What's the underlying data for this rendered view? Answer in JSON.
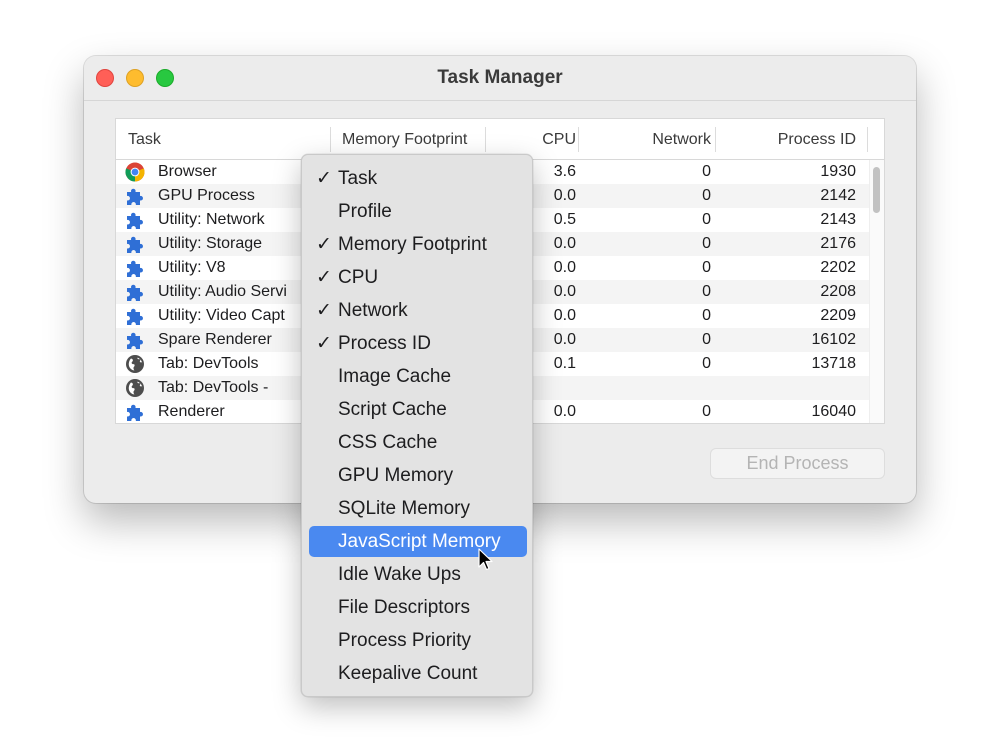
{
  "window": {
    "title": "Task Manager"
  },
  "table": {
    "columns": [
      "Task",
      "Memory Footprint",
      "CPU",
      "Network",
      "Process ID"
    ],
    "rows": [
      {
        "icon": "chrome-icon",
        "task": "Browser",
        "cpu": "3.6",
        "network": "0",
        "pid": "1930"
      },
      {
        "icon": "puzzle-icon",
        "task": "GPU Process",
        "cpu": "0.0",
        "network": "0",
        "pid": "2142"
      },
      {
        "icon": "puzzle-icon",
        "task": "Utility: Network",
        "cpu": "0.5",
        "network": "0",
        "pid": "2143"
      },
      {
        "icon": "puzzle-icon",
        "task": "Utility: Storage",
        "cpu": "0.0",
        "network": "0",
        "pid": "2176"
      },
      {
        "icon": "puzzle-icon",
        "task": "Utility: V8",
        "cpu": "0.0",
        "network": "0",
        "pid": "2202"
      },
      {
        "icon": "puzzle-icon",
        "task": "Utility: Audio Servi",
        "cpu": "0.0",
        "network": "0",
        "pid": "2208"
      },
      {
        "icon": "puzzle-icon",
        "task": "Utility: Video Capt",
        "cpu": "0.0",
        "network": "0",
        "pid": "2209"
      },
      {
        "icon": "puzzle-icon",
        "task": "Spare Renderer",
        "cpu": "0.0",
        "network": "0",
        "pid": "16102"
      },
      {
        "icon": "globe-icon",
        "task": "Tab: DevTools",
        "cpu": "0.1",
        "network": "0",
        "pid": "13718"
      },
      {
        "icon": "globe-icon",
        "task": "Tab: DevTools -",
        "cpu": "",
        "network": "",
        "pid": ""
      },
      {
        "icon": "puzzle-icon",
        "task": "Renderer",
        "cpu": "0.0",
        "network": "0",
        "pid": "16040"
      }
    ]
  },
  "end_process_label": "End Process",
  "context_menu": {
    "items": [
      {
        "label": "Task",
        "checked": true
      },
      {
        "label": "Profile",
        "checked": false
      },
      {
        "label": "Memory Footprint",
        "checked": true
      },
      {
        "label": "CPU",
        "checked": true
      },
      {
        "label": "Network",
        "checked": true
      },
      {
        "label": "Process ID",
        "checked": true
      },
      {
        "label": "Image Cache",
        "checked": false
      },
      {
        "label": "Script Cache",
        "checked": false
      },
      {
        "label": "CSS Cache",
        "checked": false
      },
      {
        "label": "GPU Memory",
        "checked": false
      },
      {
        "label": "SQLite Memory",
        "checked": false
      },
      {
        "label": "JavaScript Memory",
        "checked": false,
        "highlighted": true
      },
      {
        "label": "Idle Wake Ups",
        "checked": false
      },
      {
        "label": "File Descriptors",
        "checked": false
      },
      {
        "label": "Process Priority",
        "checked": false
      },
      {
        "label": "Keepalive Count",
        "checked": false
      }
    ],
    "check_glyph": "✓"
  },
  "colors": {
    "highlight": "#4a89f0",
    "puzzle": "#2f6fd6"
  }
}
